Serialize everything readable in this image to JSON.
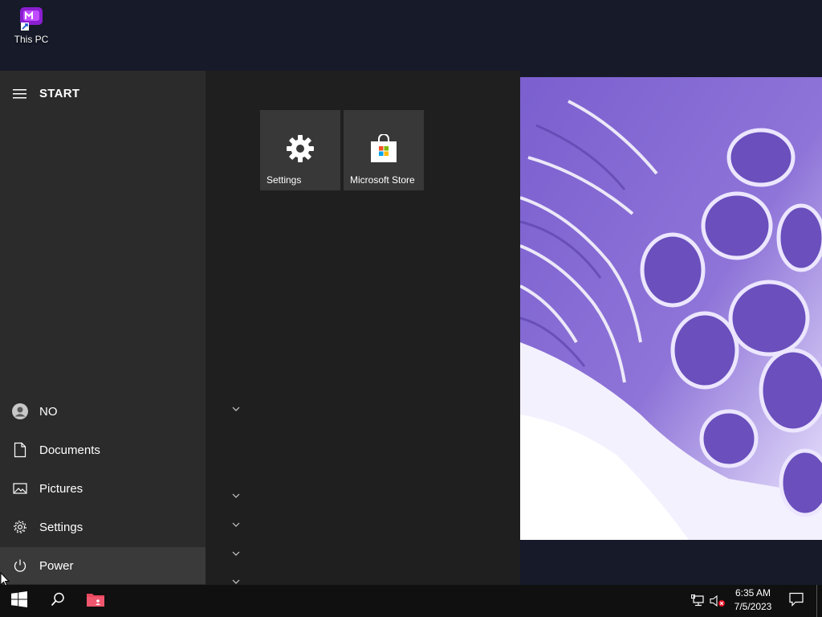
{
  "desktop": {
    "icons": [
      {
        "label": "This PC",
        "icon": "this-pc-icon"
      }
    ]
  },
  "start_menu": {
    "title": "START",
    "user": "NO",
    "nav": [
      {
        "label": "Documents",
        "icon": "document-icon"
      },
      {
        "label": "Pictures",
        "icon": "pictures-icon"
      },
      {
        "label": "Settings",
        "icon": "gear-icon"
      },
      {
        "label": "Power",
        "icon": "power-icon"
      }
    ],
    "tiles": [
      {
        "label": "Settings",
        "icon": "gear-icon"
      },
      {
        "label": "Microsoft Store",
        "icon": "store-bag-icon"
      }
    ]
  },
  "taskbar": {
    "time": "6:35 AM",
    "date": "7/5/2023"
  },
  "colors": {
    "start_left": "#2b2b2b",
    "start_right": "#1f1f1f",
    "tile": "#383838",
    "taskbar": "#101010",
    "folder_accent": "#e8475f",
    "wallpaper_accent": "#7a5ad0"
  }
}
